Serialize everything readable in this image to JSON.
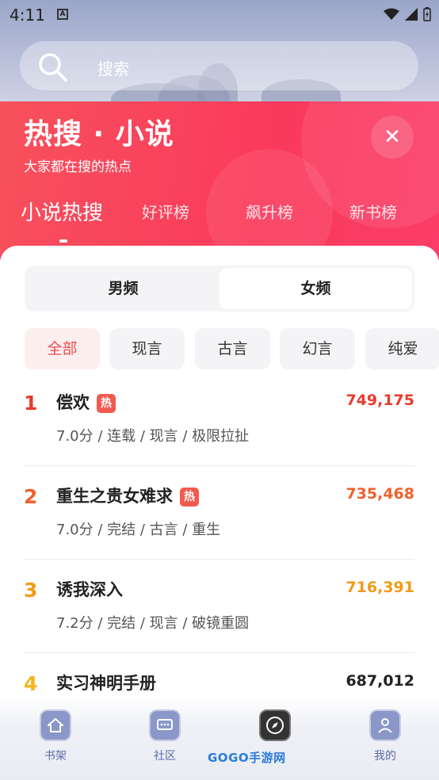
{
  "status_bar": {
    "time": "4:11"
  },
  "search": {
    "placeholder": "搜索"
  },
  "hero": {
    "title": "热搜 · 小说",
    "subtitle": "大家都在搜的热点"
  },
  "tabs": [
    {
      "label": "小说热搜"
    },
    {
      "label": "好评榜"
    },
    {
      "label": "飙升榜"
    },
    {
      "label": "新书榜"
    }
  ],
  "gender_toggle": {
    "options": [
      "男频",
      "女频"
    ],
    "selected": "女频"
  },
  "categories": [
    "全部",
    "现言",
    "古言",
    "幻言",
    "纯爱"
  ],
  "selected_category": "全部",
  "rank_colors": {
    "1": "#e93b2e",
    "2": "#f0612e",
    "3": "#f29a18",
    "4": "#f2b51c"
  },
  "list": [
    {
      "rank": "1",
      "title": "偿欢",
      "hot": "热",
      "meta": "7.0分 / 连载 / 现言 / 极限拉扯",
      "score": "749,175",
      "score_color": "#e93b2e"
    },
    {
      "rank": "2",
      "title": "重生之贵女难求",
      "hot": "热",
      "meta": "7.0分 / 完结 / 古言 / 重生",
      "score": "735,468",
      "score_color": "#f0612e"
    },
    {
      "rank": "3",
      "title": "诱我深入",
      "hot": "",
      "meta": "7.2分 / 完结 / 现言 / 破镜重圆",
      "score": "716,391",
      "score_color": "#f29a18"
    },
    {
      "rank": "4",
      "title": "实习神明手册",
      "hot": "",
      "meta": "",
      "score": "687,012",
      "score_color": "#222222"
    }
  ],
  "bottom_nav": [
    {
      "label": "书架",
      "icon": "house-icon"
    },
    {
      "label": "社区",
      "icon": "chat-icon"
    },
    {
      "label": "",
      "icon": "compass-icon"
    },
    {
      "label": "我的",
      "icon": "person-icon"
    }
  ],
  "watermark": "GOGO手游网"
}
